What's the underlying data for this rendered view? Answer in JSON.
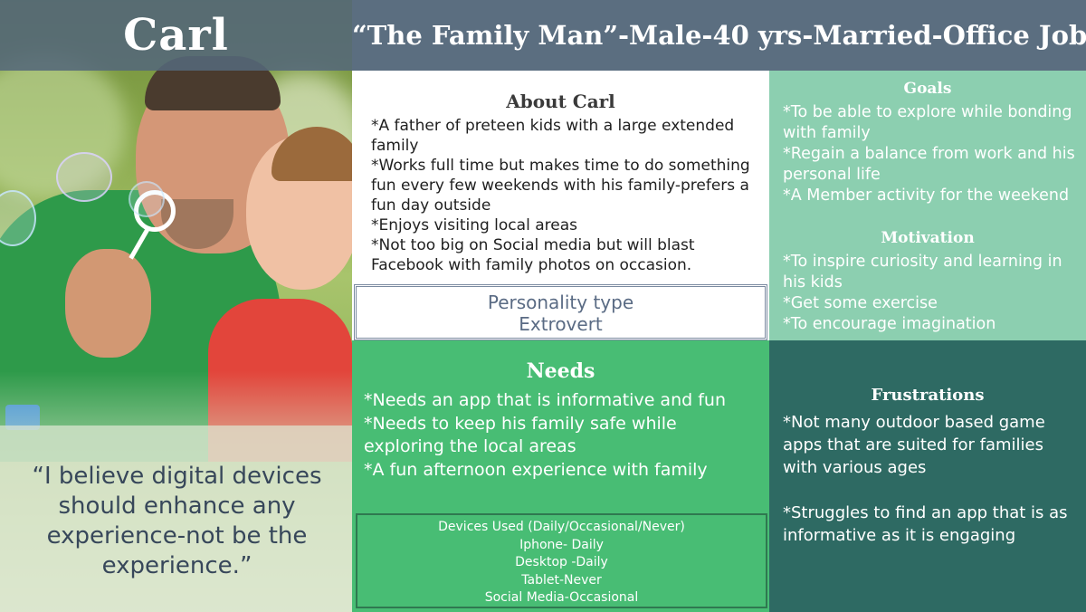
{
  "persona": {
    "name": "Carl",
    "quote": "“I believe digital devices should enhance any experience-not be the experience.”"
  },
  "title": "“The Family Man”-Male-40 yrs-Married-Office Job",
  "about": {
    "title": "About Carl",
    "items": [
      "*A father of preteen kids with a large extended family",
      "*Works full time but makes time to do something fun every few weekends with his family-prefers a fun day outside",
      "*Enjoys visiting local areas",
      "*Not too big on Social media but will blast Facebook with family photos on occasion."
    ]
  },
  "personality": {
    "label": "Personality type",
    "value": "Extrovert"
  },
  "goals": {
    "title": "Goals",
    "items": [
      "*To be able to explore while bonding with family",
      "*Regain a balance from work and his personal life",
      "*A Member activity for the weekend"
    ]
  },
  "motivation": {
    "title": "Motivation",
    "items": [
      "*To inspire curiosity and learning in his kids",
      "*Get some exercise",
      "*To encourage imagination"
    ]
  },
  "needs": {
    "title": "Needs",
    "items": [
      "*Needs an app that is informative and fun",
      "*Needs to keep his family safe while exploring the local areas",
      "*A fun afternoon experience with family"
    ]
  },
  "devices": {
    "title": "Devices Used (Daily/Occasional/Never)",
    "items": [
      "Iphone- Daily",
      "Desktop -Daily",
      "Tablet-Never",
      "Social Media-Occasional"
    ]
  },
  "frustrations": {
    "title": "Frustrations",
    "items": [
      "*Not many outdoor based game apps that are suited for families with various ages",
      "*Struggles to find an app that is as informative as it is engaging"
    ]
  }
}
